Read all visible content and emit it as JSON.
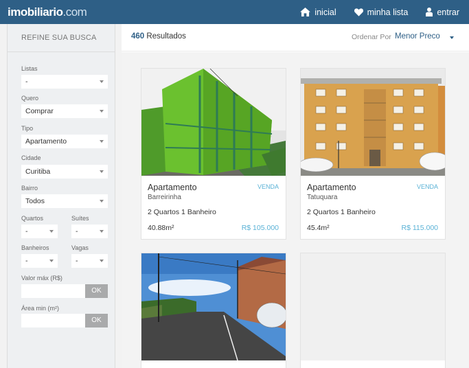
{
  "header": {
    "logo_main": "imobiliario",
    "logo_suffix": ".com",
    "nav": [
      {
        "label": "inicial",
        "icon": "home-icon"
      },
      {
        "label": "minha lista",
        "icon": "heart-icon"
      },
      {
        "label": "entrar",
        "icon": "user-icon"
      }
    ]
  },
  "sidebar": {
    "title": "REFINE SUA BUSCA",
    "listas": {
      "label": "Listas",
      "value": "-"
    },
    "quero": {
      "label": "Quero",
      "value": "Comprar"
    },
    "tipo": {
      "label": "Tipo",
      "value": "Apartamento"
    },
    "cidade": {
      "label": "Cidade",
      "value": "Curitiba"
    },
    "bairro": {
      "label": "Bairro",
      "value": "Todos"
    },
    "quartos": {
      "label": "Quartos",
      "value": "-"
    },
    "suites": {
      "label": "Suítes",
      "value": "-"
    },
    "banheiros": {
      "label": "Banheiros",
      "value": "-"
    },
    "vagas": {
      "label": "Vagas",
      "value": "-"
    },
    "valor_max": {
      "label": "Valor máx (R$)",
      "value": "",
      "ok": "OK"
    },
    "area_min": {
      "label": "Área min (m²)",
      "value": "",
      "ok": "OK"
    }
  },
  "results": {
    "count": "460",
    "label": "Resultados",
    "order_label": "Ordenar Por",
    "order_value": "Menor Preco"
  },
  "listings": [
    {
      "type": "Apartamento",
      "tag": "VENDA",
      "neighborhood": "Barreirinha",
      "rooms_n": "2",
      "rooms_label": "Quartos",
      "baths_n": "1",
      "baths_label": "Banheiro",
      "area": "40.88m²",
      "price": "R$ 105.000"
    },
    {
      "type": "Apartamento",
      "tag": "VENDA",
      "neighborhood": "Tatuquara",
      "rooms_n": "2",
      "rooms_label": "Quartos",
      "baths_n": "1",
      "baths_label": "Banheiro",
      "area": "45.4m²",
      "price": "R$ 115.000"
    }
  ],
  "colors": {
    "brand": "#2e5f86",
    "accent": "#5ab2d6",
    "building_green": "#6bc12f",
    "building_orange": "#d9a24e"
  }
}
